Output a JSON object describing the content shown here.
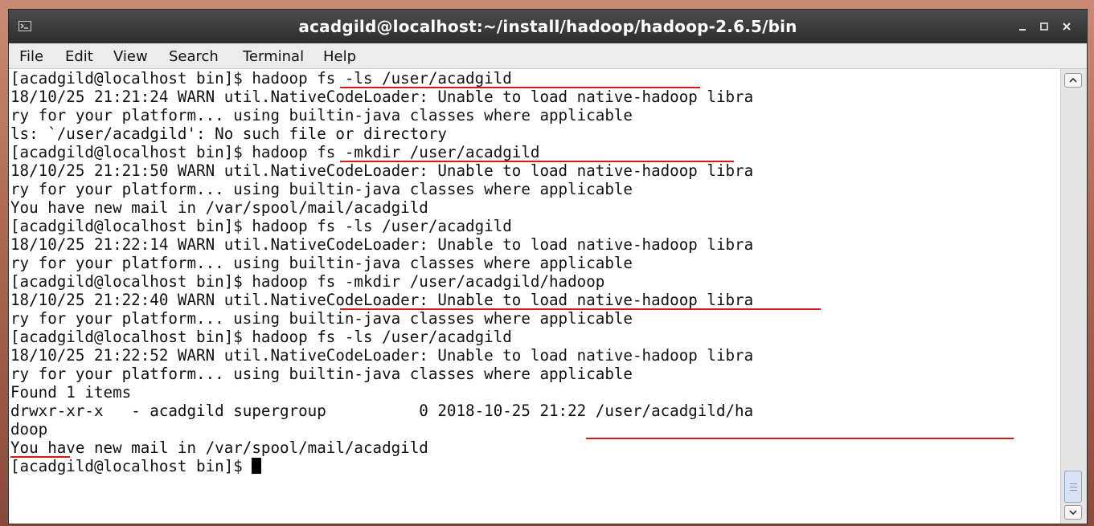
{
  "window": {
    "title": "acadgild@localhost:~/install/hadoop/hadoop-2.6.5/bin",
    "controls": [
      "minimize-icon",
      "maximize-icon",
      "close-icon"
    ],
    "title_icon": "terminal-icon"
  },
  "menu": [
    "File",
    "Edit",
    "View",
    "Search",
    "Terminal",
    "Help"
  ],
  "terminal": {
    "lines": [
      "[acadgild@localhost bin]$ hadoop fs -ls /user/acadgild",
      "18/10/25 21:21:24 WARN util.NativeCodeLoader: Unable to load native-hadoop libra",
      "ry for your platform... using builtin-java classes where applicable",
      "ls: `/user/acadgild': No such file or directory",
      "[acadgild@localhost bin]$ hadoop fs -mkdir /user/acadgild",
      "18/10/25 21:21:50 WARN util.NativeCodeLoader: Unable to load native-hadoop libra",
      "ry for your platform... using builtin-java classes where applicable",
      "You have new mail in /var/spool/mail/acadgild",
      "[acadgild@localhost bin]$ hadoop fs -ls /user/acadgild",
      "18/10/25 21:22:14 WARN util.NativeCodeLoader: Unable to load native-hadoop libra",
      "ry for your platform... using builtin-java classes where applicable",
      "[acadgild@localhost bin]$ hadoop fs -mkdir /user/acadgild/hadoop",
      "18/10/25 21:22:40 WARN util.NativeCodeLoader: Unable to load native-hadoop libra",
      "ry for your platform... using builtin-java classes where applicable",
      "[acadgild@localhost bin]$ hadoop fs -ls /user/acadgild",
      "18/10/25 21:22:52 WARN util.NativeCodeLoader: Unable to load native-hadoop libra",
      "ry for your platform... using builtin-java classes where applicable",
      "Found 1 items",
      "drwxr-xr-x   - acadgild supergroup          0 2018-10-25 21:22 /user/acadgild/ha",
      "doop",
      "You have new mail in /var/spool/mail/acadgild",
      "[acadgild@localhost bin]$ "
    ]
  },
  "colors": {
    "annotation": "#d8171c",
    "titlebar": "#3a3a3a",
    "terminal_bg": "#ffffff",
    "terminal_fg": "#111111"
  }
}
